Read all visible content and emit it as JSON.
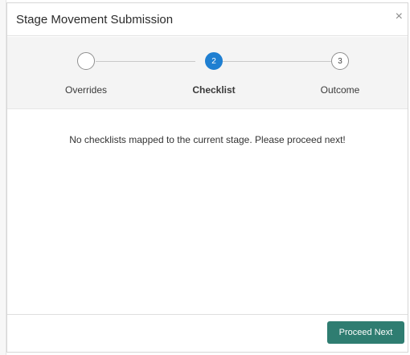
{
  "dialog": {
    "title": "Stage Movement Submission",
    "close_icon": "×"
  },
  "stepper": {
    "steps": [
      {
        "label": "Overrides",
        "number": "",
        "status": "completed"
      },
      {
        "label": "Checklist",
        "number": "2",
        "status": "active"
      },
      {
        "label": "Outcome",
        "number": "3",
        "status": "pending"
      }
    ]
  },
  "content": {
    "message": "No checklists mapped to the current stage. Please proceed next!"
  },
  "footer": {
    "proceed_label": "Proceed Next"
  },
  "colors": {
    "accent": "#1f7fd1",
    "button": "#2f7d71"
  }
}
